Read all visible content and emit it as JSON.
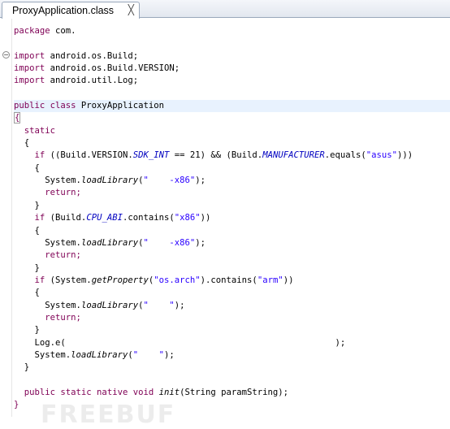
{
  "tab": {
    "title": "ProxyApplication.class",
    "close_glyph": "╳"
  },
  "code": {
    "package_kw": "package",
    "package_name": " com.",
    "imports": [
      {
        "kw": "import",
        "rest": " android.os.Build;"
      },
      {
        "kw": "import",
        "rest": " android.os.Build.VERSION;"
      },
      {
        "kw": "import",
        "rest": " android.util.Log;"
      }
    ],
    "class_kw": "public class",
    "class_name": " ProxyApplication",
    "open_brace": "{",
    "static_kw": "static",
    "l_open": "{",
    "if1": {
      "kw": "if",
      "p1": " ((Build.VERSION.",
      "f1": "SDK_INT",
      "p2": " == 21) && (Build.",
      "f2": "MANUFACTURER",
      "p3": ".equals(",
      "s": "\"asus\"",
      "p4": ")))"
    },
    "block1": {
      "open": "{",
      "call_pre": "System.",
      "call_m": "loadLibrary",
      "call_lp": "(",
      "s": "\"    -x86\"",
      "end": ");",
      "ret": "return;",
      "close": "}"
    },
    "if2": {
      "kw": "if",
      "p1": " (Build.",
      "f": "CPU_ABI",
      "p2": ".contains(",
      "s": "\"x86\"",
      "p3": "))"
    },
    "block2": {
      "open": "{",
      "call_pre": "System.",
      "call_m": "loadLibrary",
      "call_lp": "(",
      "s": "\"    -x86\"",
      "end": ");",
      "ret": "return;",
      "close": "}"
    },
    "if3": {
      "kw": "if",
      "p1": " (System.",
      "m": "getProperty",
      "p2": "(",
      "s1": "\"os.arch\"",
      "p3": ").contains(",
      "s2": "\"arm\"",
      "p4": "))"
    },
    "block3": {
      "open": "{",
      "call_pre": "System.",
      "call_m": "loadLibrary",
      "call_lp": "(",
      "s": "\"    \"",
      "end": ");",
      "ret": "return;",
      "close": "}"
    },
    "log_line": "Log.e(                                                    );",
    "final_call": {
      "pre": "System.",
      "m": "loadLibrary",
      "lp": "(",
      "s": "\"    \"",
      "end": ");"
    },
    "static_close": "}",
    "native": {
      "kw": "public static native void",
      "m": "init",
      "rest": "(String paramString);"
    },
    "class_close": "}"
  },
  "watermark": "FREEBUF",
  "colors": {
    "keyword": "#7f0055",
    "string": "#2a00ff",
    "field": "#0000c0",
    "highlight": "#e8f2fe"
  }
}
